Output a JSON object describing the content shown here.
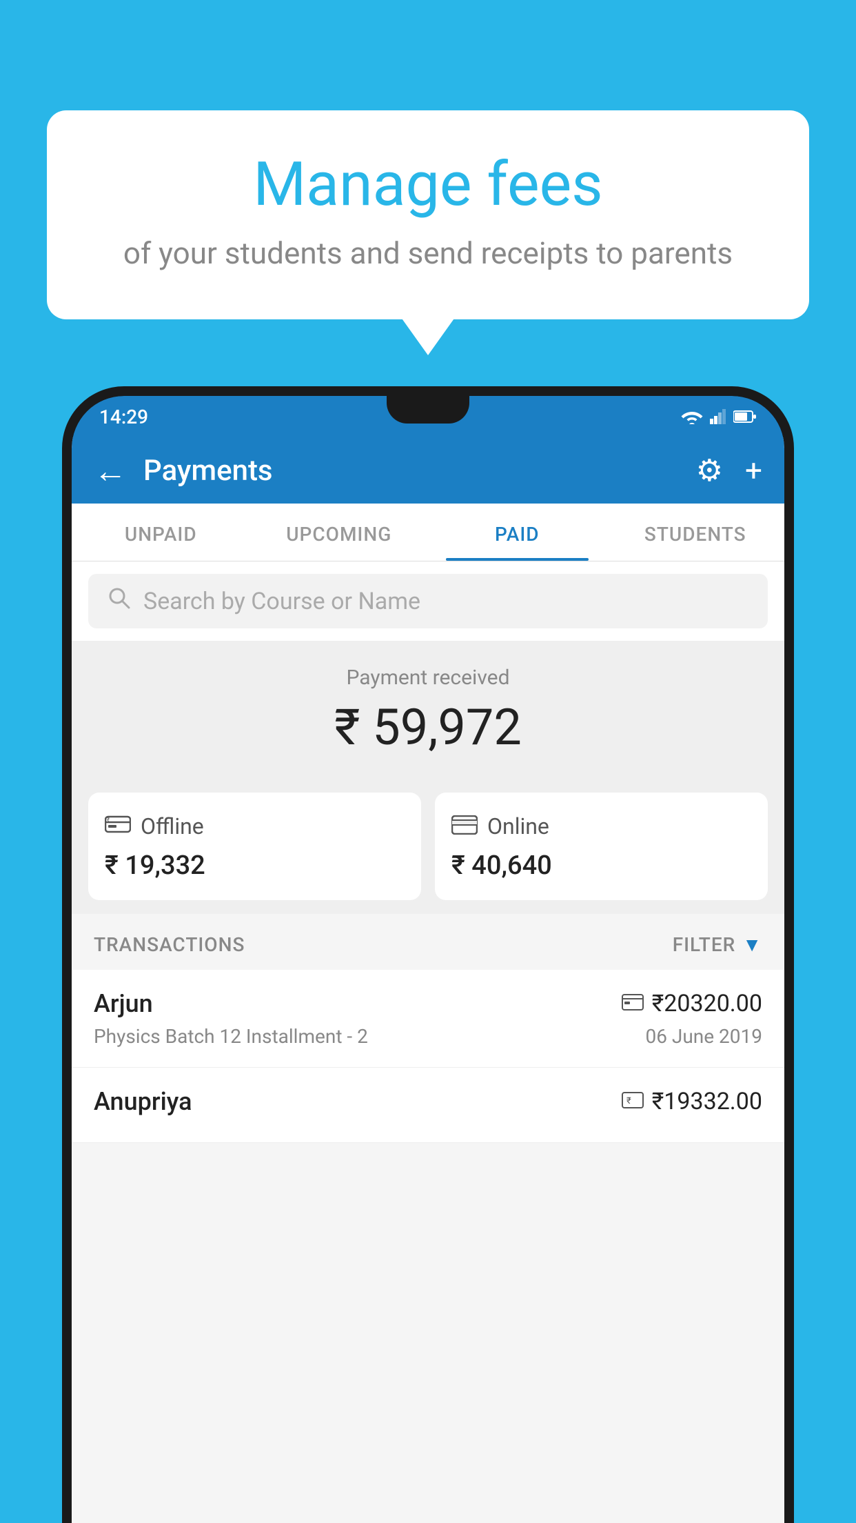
{
  "background_color": "#29b6e8",
  "speech_bubble": {
    "title": "Manage fees",
    "subtitle": "of your students and send receipts to parents"
  },
  "status_bar": {
    "time": "14:29"
  },
  "app_bar": {
    "title": "Payments",
    "back_label": "←",
    "settings_icon": "⚙",
    "add_icon": "+"
  },
  "tabs": [
    {
      "label": "UNPAID",
      "active": false
    },
    {
      "label": "UPCOMING",
      "active": false
    },
    {
      "label": "PAID",
      "active": true
    },
    {
      "label": "STUDENTS",
      "active": false
    }
  ],
  "search": {
    "placeholder": "Search by Course or Name"
  },
  "payment_received": {
    "label": "Payment received",
    "amount": "₹ 59,972"
  },
  "payment_cards": [
    {
      "type": "Offline",
      "amount": "₹ 19,332",
      "icon": "💳"
    },
    {
      "type": "Online",
      "amount": "₹ 40,640",
      "icon": "💳"
    }
  ],
  "transactions_section": {
    "label": "TRANSACTIONS",
    "filter_label": "FILTER"
  },
  "transactions": [
    {
      "name": "Arjun",
      "detail": "Physics Batch 12 Installment - 2",
      "amount": "₹20320.00",
      "date": "06 June 2019",
      "type_icon": "card"
    },
    {
      "name": "Anupriya",
      "detail": "",
      "amount": "₹19332.00",
      "date": "",
      "type_icon": "cash"
    }
  ]
}
